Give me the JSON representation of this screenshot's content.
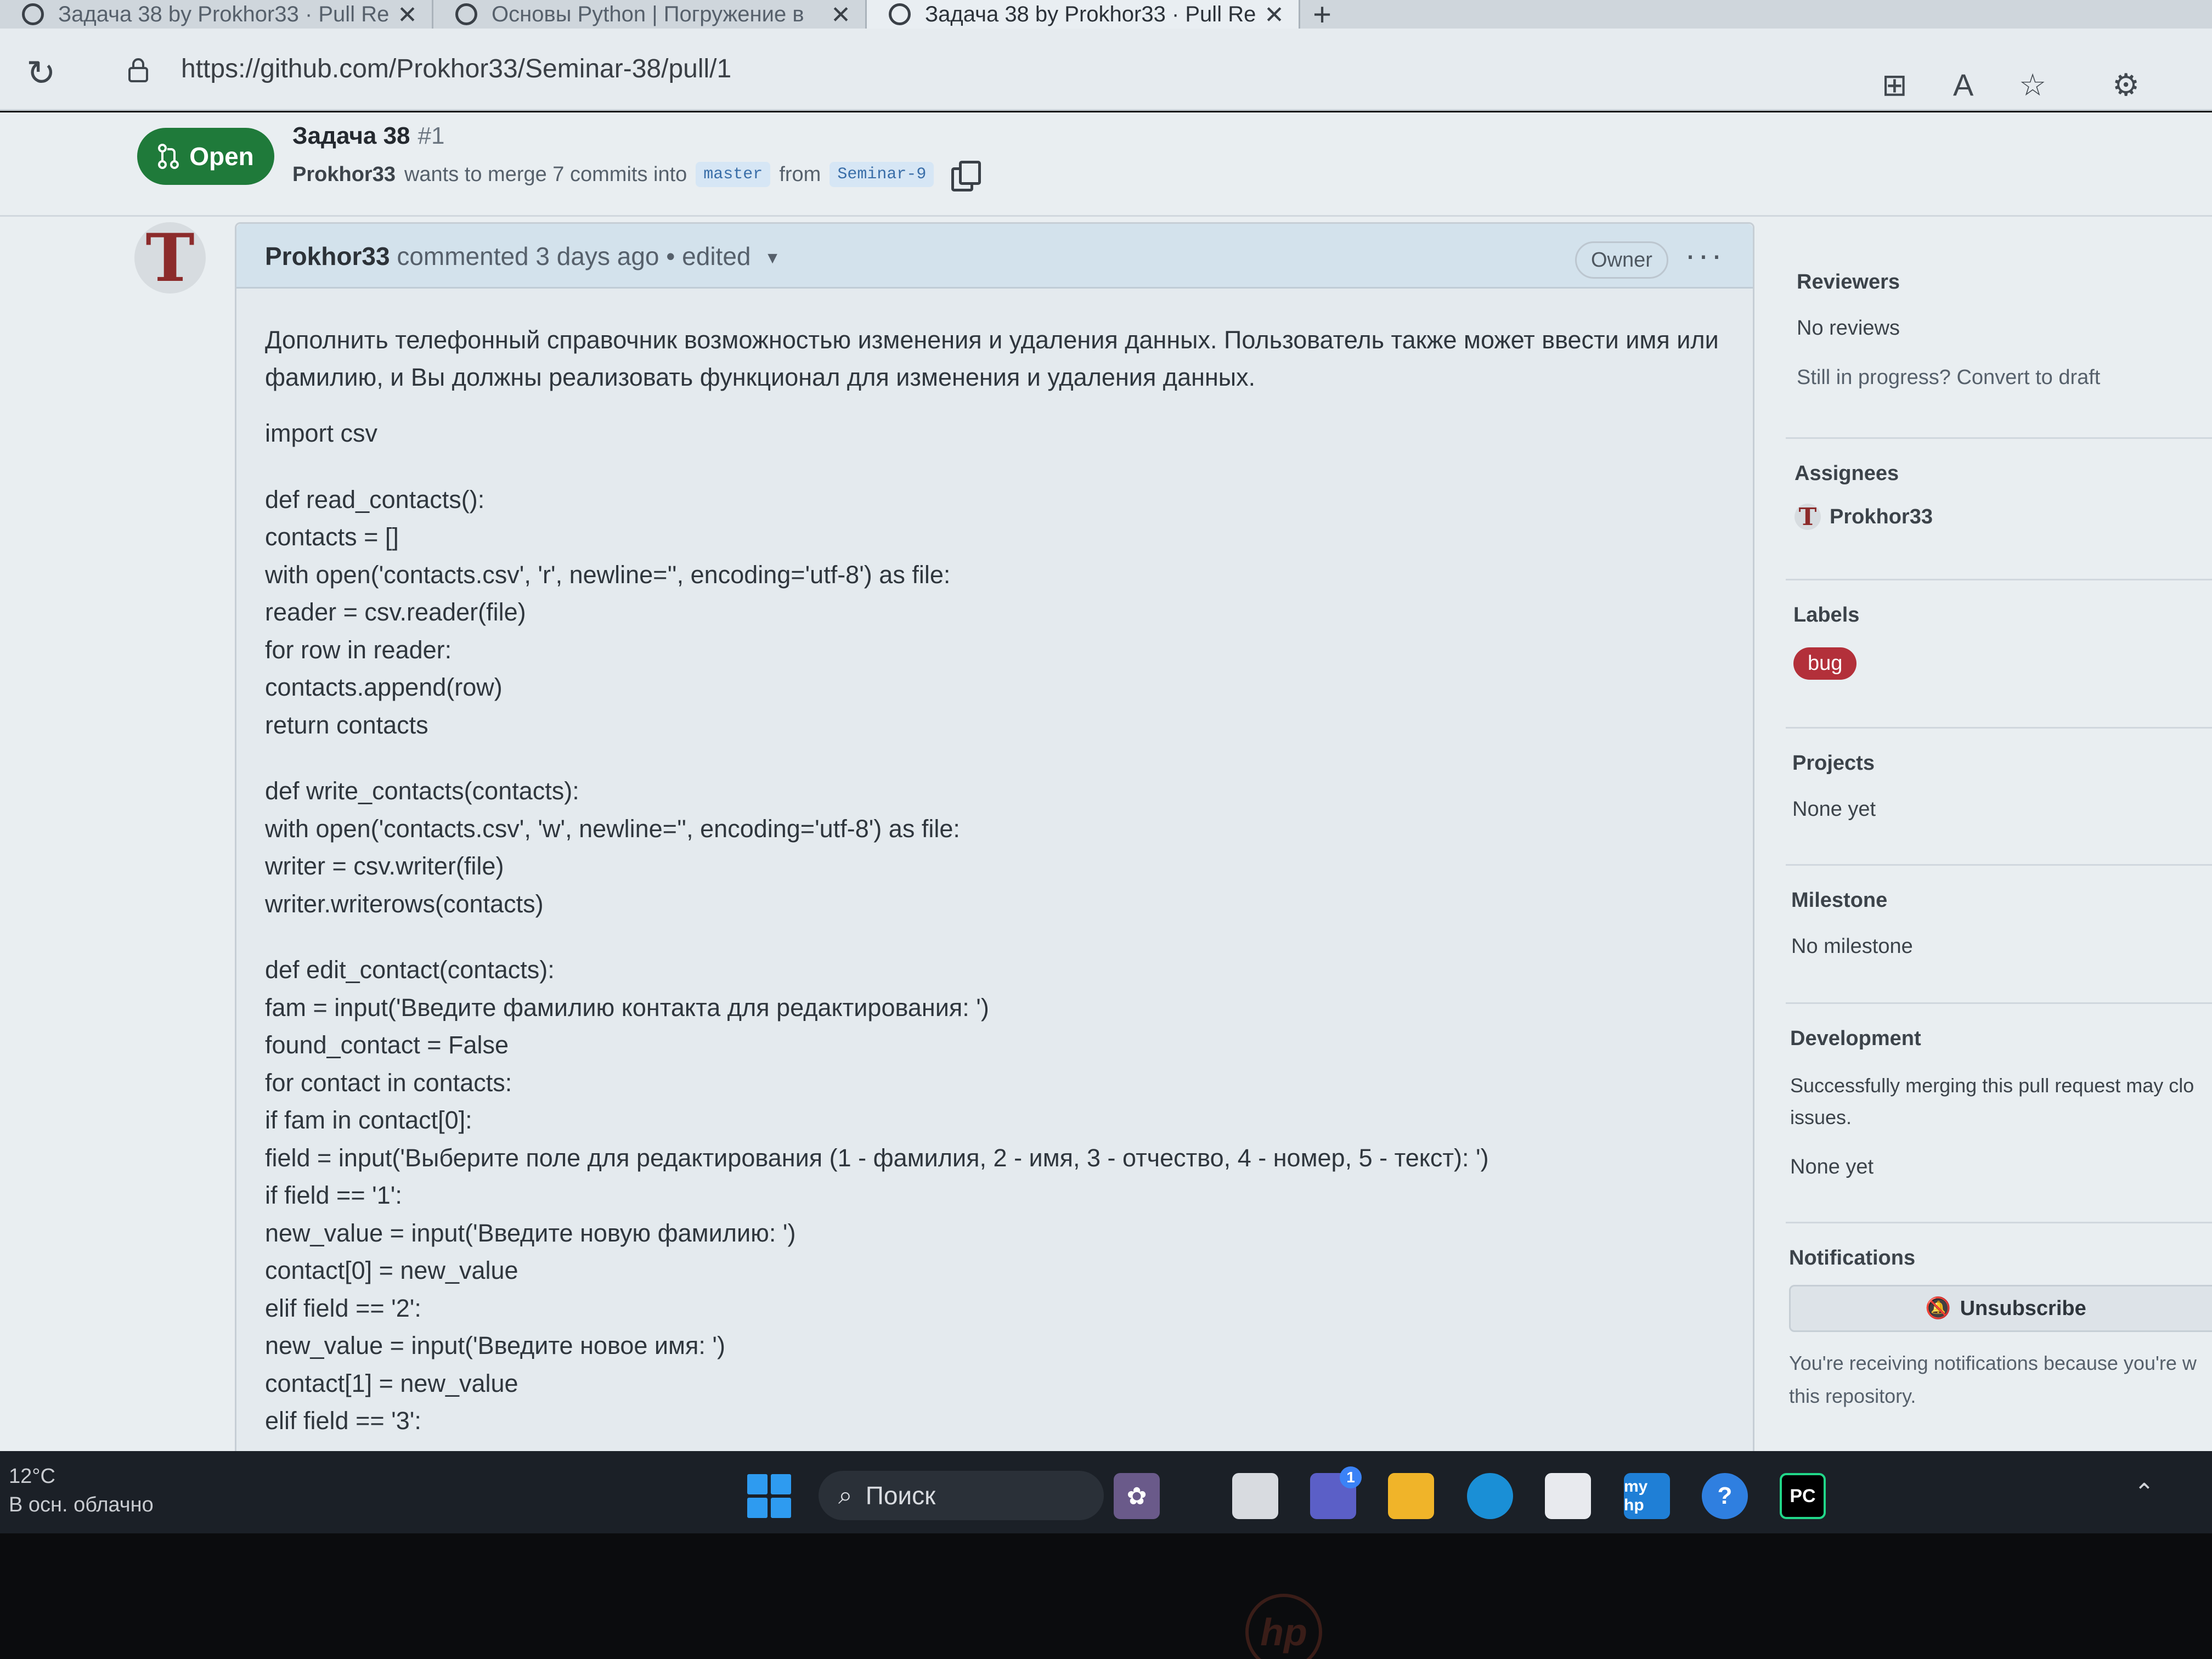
{
  "browser": {
    "tabs": [
      {
        "title": "Задача 38 by Prokhor33 · Pull Re",
        "active": false
      },
      {
        "title": "Основы Python | Погружение в",
        "active": false
      },
      {
        "title": "Задача 38 by Prokhor33 · Pull Re",
        "active": true
      }
    ],
    "new_tab": "+",
    "url": "https://github.com/Prokhor33/Seminar-38/pull/1"
  },
  "pr": {
    "state": "Open",
    "title": "Задача 38",
    "number": "#1",
    "author": "Prokhor33",
    "merge_text": "wants to merge 7 commits into",
    "base_branch": "master",
    "from_text": "from",
    "head_branch": "Seminar-9"
  },
  "comment": {
    "author": "Prokhor33",
    "meta": "commented 3 days ago • edited",
    "owner_badge": "Owner",
    "menu": "···",
    "description": "Дополнить телефонный справочник возможностью изменения и удаления данных. Пользователь также может ввести имя или фамилию, и Вы должны реализовать функционал для изменения и удаления данных.",
    "code_blocks": [
      [
        "import csv"
      ],
      [
        "def read_contacts():",
        "contacts = []",
        "with open('contacts.csv', 'r', newline='', encoding='utf-8') as file:",
        "reader = csv.reader(file)",
        "for row in reader:",
        "contacts.append(row)",
        "return contacts"
      ],
      [
        "def write_contacts(contacts):",
        "with open('contacts.csv', 'w', newline='', encoding='utf-8') as file:",
        "writer = csv.writer(file)",
        "writer.writerows(contacts)"
      ],
      [
        "def edit_contact(contacts):",
        "fam = input('Введите фамилию контакта для редактирования: ')",
        "found_contact = False",
        "for contact in contacts:",
        "if fam in contact[0]:",
        "field = input('Выберите поле для редактирования (1 - фамилия, 2 - имя, 3 - отчество, 4 - номер, 5 - текст): ')",
        "if field == '1':",
        "new_value = input('Введите новую фамилию: ')",
        "contact[0] = new_value",
        "elif field == '2':",
        "new_value = input('Введите новое имя: ')",
        "contact[1] = new_value",
        "elif field == '3':"
      ]
    ]
  },
  "sidebar": {
    "reviewers": {
      "title": "Reviewers",
      "value": "No reviews",
      "draft_hint": "Still in progress? Convert to draft"
    },
    "assignees": {
      "title": "Assignees",
      "value": "Prokhor33"
    },
    "labels": {
      "title": "Labels",
      "value": "bug",
      "color": "#b3303a"
    },
    "projects": {
      "title": "Projects",
      "value": "None yet"
    },
    "milestone": {
      "title": "Milestone",
      "value": "No milestone"
    },
    "development": {
      "title": "Development",
      "text1": "Successfully merging this pull request may clo",
      "text2": "issues.",
      "value": "None yet"
    },
    "notifications": {
      "title": "Notifications",
      "button": "Unsubscribe",
      "text1": "You're receiving notifications because you're w",
      "text2": "this repository."
    }
  },
  "taskbar": {
    "temperature": "12°C",
    "weather": "В осн. облачно",
    "search": "Поиск",
    "chat_badge": "1",
    "store_label": "my hp",
    "help": "?",
    "pycharm": "PC"
  },
  "colors": {
    "open_green": "#1f7a3a",
    "bug_red": "#b3303a",
    "branch_blue": "#3a6ea8"
  }
}
